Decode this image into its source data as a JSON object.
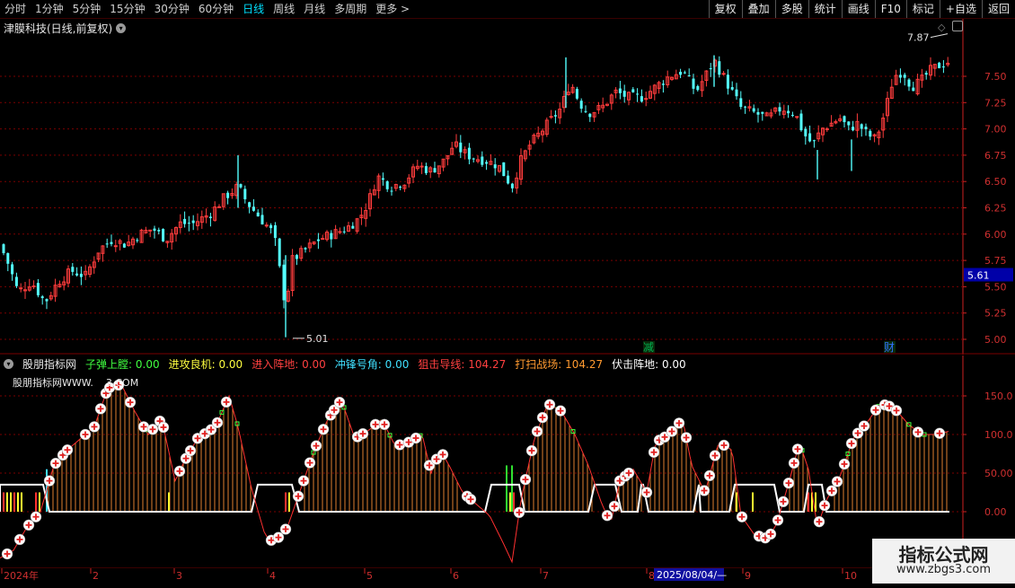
{
  "toolbar": {
    "periods": [
      "分时",
      "1分钟",
      "5分钟",
      "15分钟",
      "30分钟",
      "60分钟",
      "日线",
      "周线",
      "月线",
      "多周期",
      "更多 >"
    ],
    "active_period": "日线",
    "right_buttons": [
      "复权",
      "叠加",
      "多股",
      "统计",
      "画线",
      "F10",
      "标记",
      "+自选",
      "返回"
    ]
  },
  "price_panel": {
    "title": "津膜科技(日线,前复权)",
    "high_label": "7.87",
    "low_label": "5.01",
    "current_price": "5.61",
    "y_ticks": [
      "7.50",
      "7.25",
      "7.00",
      "6.75",
      "6.50",
      "6.25",
      "6.00",
      "5.75",
      "5.50",
      "5.25",
      "5.00"
    ],
    "markers": {
      "reduce": "减",
      "finance": "财"
    }
  },
  "indicator": {
    "name": "股朋指标网",
    "subtitle": "股朋指标网WWW.",
    "subtitle_tail": "3.COM",
    "values": [
      {
        "label": "子弹上膛:",
        "value": "0.00",
        "color": "#40ff40"
      },
      {
        "label": "进攻良机:",
        "value": "0.00",
        "color": "#ffff40"
      },
      {
        "label": "进入阵地:",
        "value": "0.00",
        "color": "#ff4040"
      },
      {
        "label": "冲锋号角:",
        "value": "0.00",
        "color": "#40e0ff"
      },
      {
        "label": "狙击导线:",
        "value": "104.27",
        "color": "#ff4040"
      },
      {
        "label": "打扫战场:",
        "value": "104.27",
        "color": "#ff9a30"
      },
      {
        "label": "伏击阵地:",
        "value": "0.00",
        "color": "#ffffff"
      }
    ],
    "y_ticks": [
      "150.0",
      "100.0",
      "50.00",
      "0.00"
    ]
  },
  "time_axis": {
    "labels": [
      "2024年",
      "2",
      "3",
      "4",
      "5",
      "6",
      "7",
      "8",
      "9",
      "10"
    ],
    "cursor_date": "2025/08/04/—"
  },
  "watermark": {
    "title": "指标公式网",
    "url": "www.zbgs3.com"
  },
  "colors": {
    "up": "#ff3c3c",
    "down": "#54ffff",
    "grid": "#7a0000",
    "axis": "#cc2020"
  }
}
